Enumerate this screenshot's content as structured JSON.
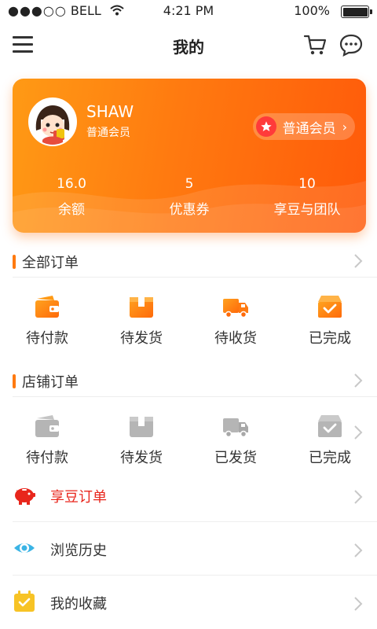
{
  "status": {
    "signal_dots": "●●●○○",
    "carrier": "BELL",
    "time": "4:21 PM",
    "battery": "100%"
  },
  "header": {
    "title": "我的",
    "icons": [
      "menu-icon",
      "cart-icon",
      "chat-icon"
    ]
  },
  "profile": {
    "name": "SHAW",
    "level": "普通会员",
    "badge": "普通会员",
    "stats": [
      {
        "value": "16.0",
        "label": "余额"
      },
      {
        "value": "5",
        "label": "优惠券"
      },
      {
        "value": "10",
        "label": "享豆与团队"
      }
    ],
    "colors": {
      "gradient_start": "#ff9a15",
      "gradient_end": "#ff5a0a",
      "badge_star": "#ff3a3a"
    }
  },
  "orders": {
    "title": "全部订单",
    "items": [
      {
        "label": "待付款",
        "icon": "wallet-icon"
      },
      {
        "label": "待发货",
        "icon": "box-icon"
      },
      {
        "label": "待收货",
        "icon": "truck-icon"
      },
      {
        "label": "已完成",
        "icon": "done-box-icon"
      }
    ],
    "accent": "#ff7a10"
  },
  "shop_orders": {
    "title": "店铺订单",
    "items": [
      {
        "label": "待付款",
        "icon": "wallet-icon"
      },
      {
        "label": "待发货",
        "icon": "box-icon"
      },
      {
        "label": "已发货",
        "icon": "truck-icon"
      },
      {
        "label": "已完成",
        "icon": "done-box-icon"
      }
    ],
    "color": "#b5b5b5"
  },
  "menu": [
    {
      "label": "享豆订单",
      "icon": "piggy-bank-icon",
      "color": "#e8261c"
    },
    {
      "label": "浏览历史",
      "icon": "eye-icon",
      "color": "#333333"
    },
    {
      "label": "我的收藏",
      "icon": "calendar-check-icon",
      "color": "#333333"
    }
  ]
}
